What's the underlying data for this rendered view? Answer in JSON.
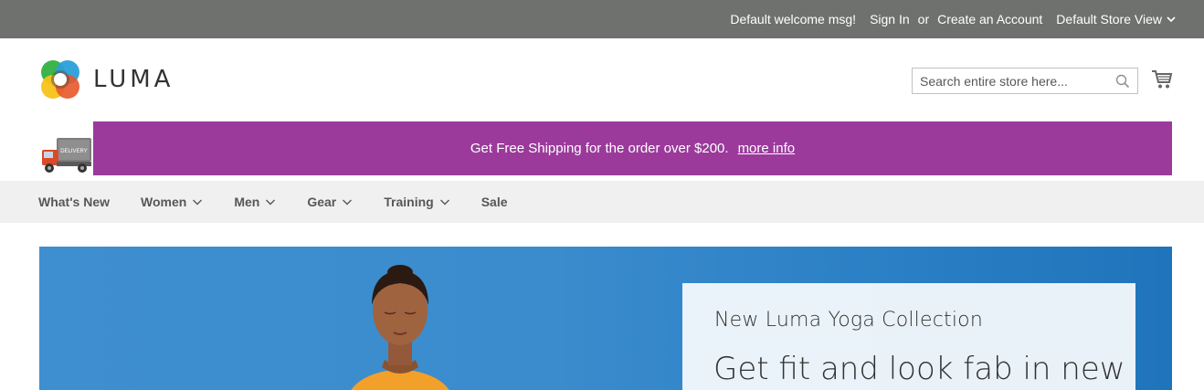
{
  "topbar": {
    "welcome": "Default welcome msg!",
    "sign_in": "Sign In",
    "or": "or",
    "create_account": "Create an Account",
    "store_view": "Default Store View"
  },
  "header": {
    "logo_text": "LUMA",
    "search_placeholder": "Search entire store here...",
    "search_value": ""
  },
  "promo": {
    "truck_label": "DELIVERY",
    "text": "Get Free Shipping for the order over $200.",
    "link": "more info",
    "color": "#9b3a9b"
  },
  "nav": {
    "items": [
      {
        "label": "What's New",
        "dropdown": false
      },
      {
        "label": "Women",
        "dropdown": true
      },
      {
        "label": "Men",
        "dropdown": true
      },
      {
        "label": "Gear",
        "dropdown": true
      },
      {
        "label": "Training",
        "dropdown": true
      },
      {
        "label": "Sale",
        "dropdown": false
      }
    ]
  },
  "hero": {
    "eyebrow": "New Luma Yoga Collection",
    "headline": "Get fit and look fab in new"
  },
  "colors": {
    "topbar": "#6e716e",
    "nav_bg": "#f0f0f0",
    "hero_blue": "#3a8ccd"
  }
}
